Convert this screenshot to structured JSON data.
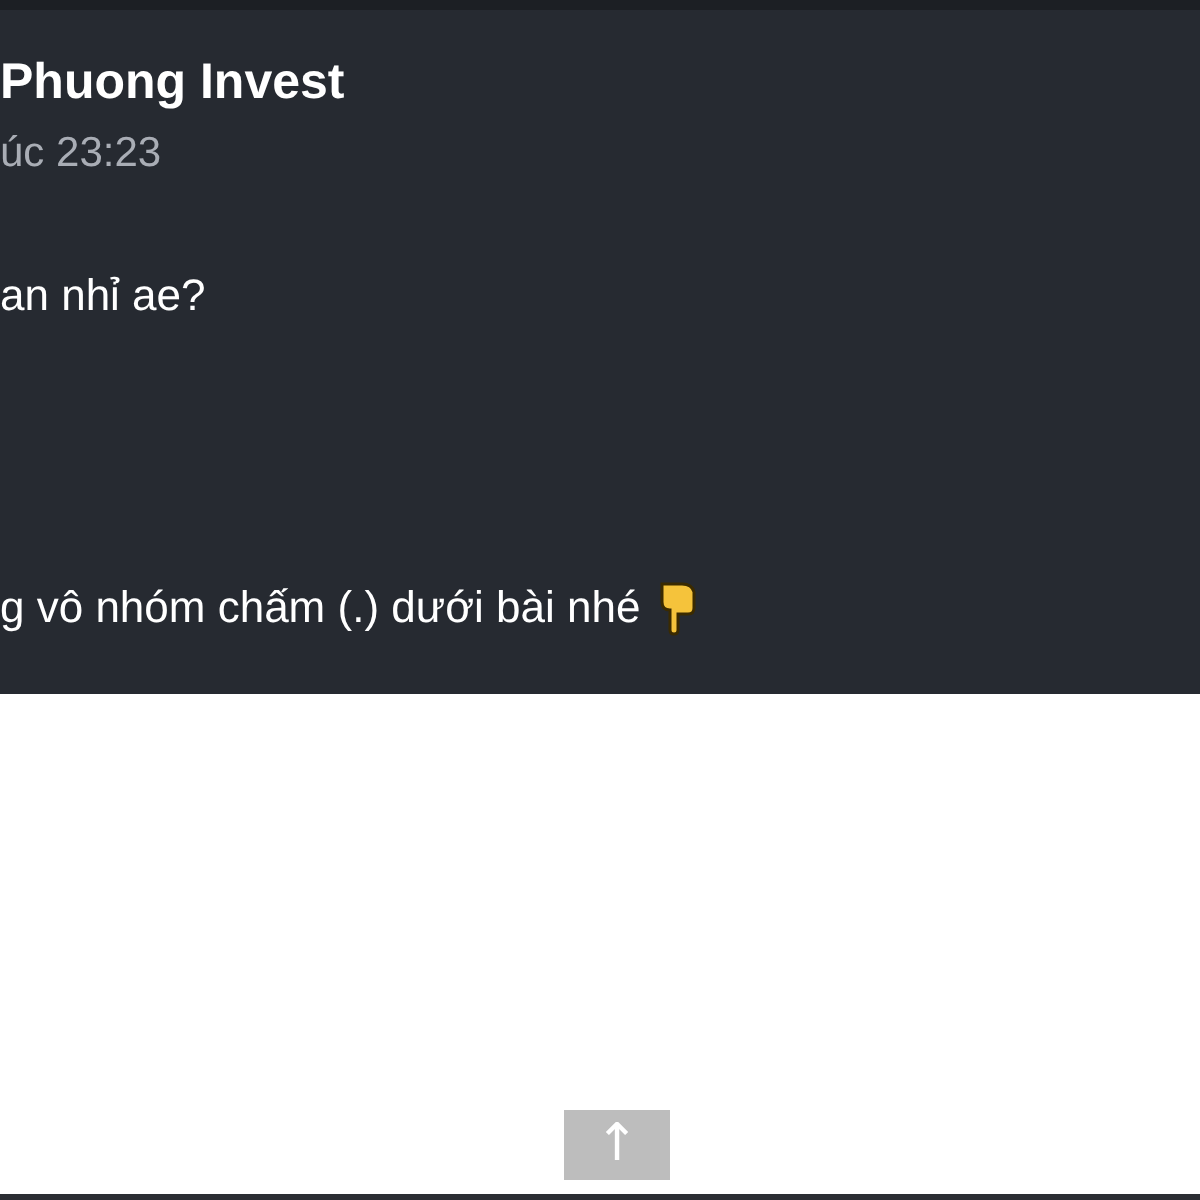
{
  "post": {
    "author": "Phuong Invest",
    "time": "úc 23:23",
    "lines": [
      "an nhỉ ae?",
      "g vô nhóm chấm (.) dưới bài nhé"
    ]
  },
  "scroll_top_button": {
    "label": "↑"
  }
}
